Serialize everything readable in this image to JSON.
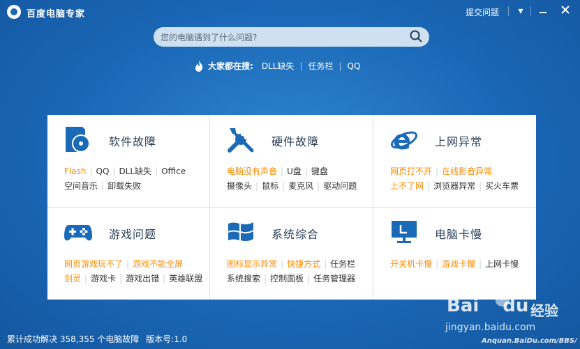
{
  "app": {
    "title": "百度电脑专家"
  },
  "titlebar": {
    "feedback": "提交问题",
    "menu_icon": "chevron-down-icon",
    "minimize_icon": "minimize-icon",
    "close_icon": "close-icon"
  },
  "search": {
    "placeholder": "您的电脑遇到了什么问题?",
    "icon": "search-icon"
  },
  "hot": {
    "label": "大家都在搜:",
    "items": [
      "DLL缺失",
      "任务栏",
      "QQ"
    ]
  },
  "categories": [
    {
      "title": "软件故障",
      "icon": "disc-icon",
      "row1": [
        "Flash",
        "QQ",
        "DLL缺失",
        "Office"
      ],
      "row1_hl": [
        true,
        false,
        false,
        false
      ],
      "row2": [
        "空间音乐",
        "卸载失败"
      ],
      "row2_hl": [
        false,
        false
      ]
    },
    {
      "title": "硬件故障",
      "icon": "tools-icon",
      "row1": [
        "电脑没有声音",
        "U盘",
        "键盘"
      ],
      "row1_hl": [
        true,
        false,
        false
      ],
      "row2": [
        "摄像头",
        "鼠标",
        "麦克风",
        "驱动问题"
      ],
      "row2_hl": [
        false,
        false,
        false,
        false
      ]
    },
    {
      "title": "上网异常",
      "icon": "ie-icon",
      "row1": [
        "网页打不开",
        "在线影音异常"
      ],
      "row1_hl": [
        true,
        true
      ],
      "row2": [
        "上不了网",
        "浏览器异常",
        "买火车票"
      ],
      "row2_hl": [
        true,
        false,
        false
      ]
    },
    {
      "title": "游戏问题",
      "icon": "gamepad-icon",
      "row1": [
        "网页游戏玩不了",
        "游戏不能全屏"
      ],
      "row1_hl": [
        true,
        true
      ],
      "row2": [
        "剑灵",
        "游戏卡",
        "游戏出错",
        "英雄联盟"
      ],
      "row2_hl": [
        true,
        false,
        false,
        false
      ]
    },
    {
      "title": "系统综合",
      "icon": "windows-icon",
      "row1": [
        "图标显示异常",
        "快捷方式",
        "任务栏"
      ],
      "row1_hl": [
        true,
        true,
        false
      ],
      "row2": [
        "系统搜索",
        "控制面板",
        "任务管理器"
      ],
      "row2_hl": [
        false,
        false,
        false
      ]
    },
    {
      "title": "电脑卡慢",
      "icon": "monitor-icon",
      "row1": [
        "开关机卡慢",
        "游戏卡慢",
        "上网卡慢"
      ],
      "row1_hl": [
        true,
        true,
        false
      ],
      "row2": [],
      "row2_hl": []
    }
  ],
  "status": {
    "prefix": "累计成功解决",
    "count": "358,355",
    "suffix": "个电脑故障",
    "version_label": "版本号:",
    "version": "1.0"
  },
  "watermark": {
    "brand": "Bai",
    "brand2": "du",
    "product": "经验",
    "url": "jingyan.baidu.com",
    "url2": "Anquan.BaiDu.com/BBS/"
  },
  "colors": {
    "accent": "#1b6ab8",
    "highlight": "#ff8a00",
    "background": "#1e6cbc"
  }
}
